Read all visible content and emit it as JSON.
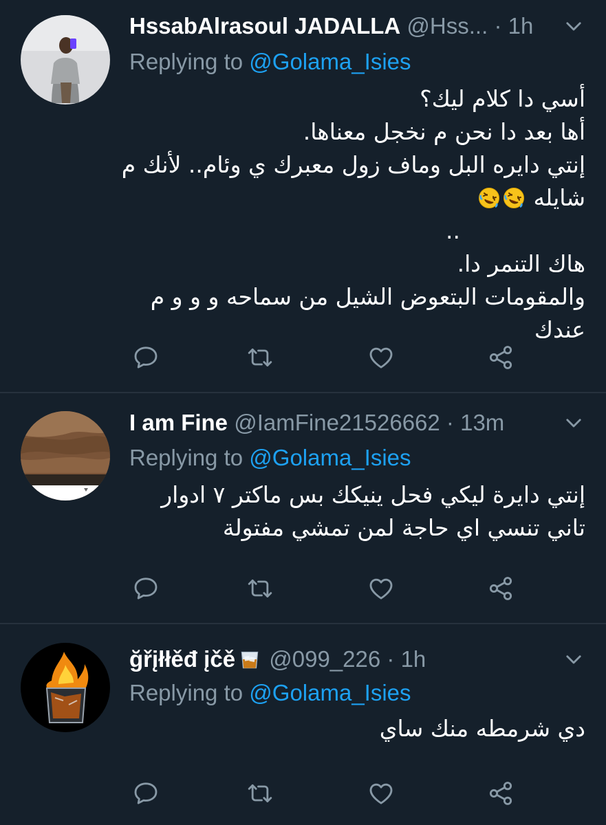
{
  "colors": {
    "background": "#15202b",
    "divider": "#26313d",
    "secondary_text": "#8899a6",
    "link": "#1da1f2",
    "primary_text": "#ffffff"
  },
  "tweets": [
    {
      "display_name": "HssabAlrasoul JADALLA",
      "handle": "@Hss...",
      "separator": "·",
      "time": "1h",
      "replying_prefix": "Replying to",
      "replying_to": "@Golama_Isies",
      "lines": [
        "أسي دا كلام ليك؟",
        "أها بعد دا نحن م نخجل معناها.",
        "إنتي دايره البل وماف زول معبرك ي وئام.. لأنك م",
        "شايله",
        "..",
        "هاك التنمر دا.",
        "والمقومات البتعوض الشيل من سماحه و و و م",
        "عندك"
      ],
      "emoji": [
        "rolling-on-floor-laughing",
        "rolling-on-floor-laughing"
      ]
    },
    {
      "display_name": "I am Fine",
      "handle": "@IamFine21526662",
      "separator": "·",
      "time": "13m",
      "replying_prefix": "Replying to",
      "replying_to": "@Golama_Isies",
      "lines": [
        "إنتي دايرة ليكي فحل ينيكك بس ماكتر ٧ ادوار",
        "تاني تنسي اي حاجة لمن تمشي مفتولة"
      ]
    },
    {
      "display_name": "ğřįłłěđ įčě",
      "name_emoji": "tumbler-glass",
      "handle": "@099_226",
      "separator": "·",
      "time": "1h",
      "replying_prefix": "Replying to",
      "replying_to": "@Golama_Isies",
      "lines": [
        "دي شرمطه منك ساي"
      ]
    }
  ],
  "action_icons": [
    "reply-icon",
    "retweet-icon",
    "like-icon",
    "share-icon"
  ]
}
